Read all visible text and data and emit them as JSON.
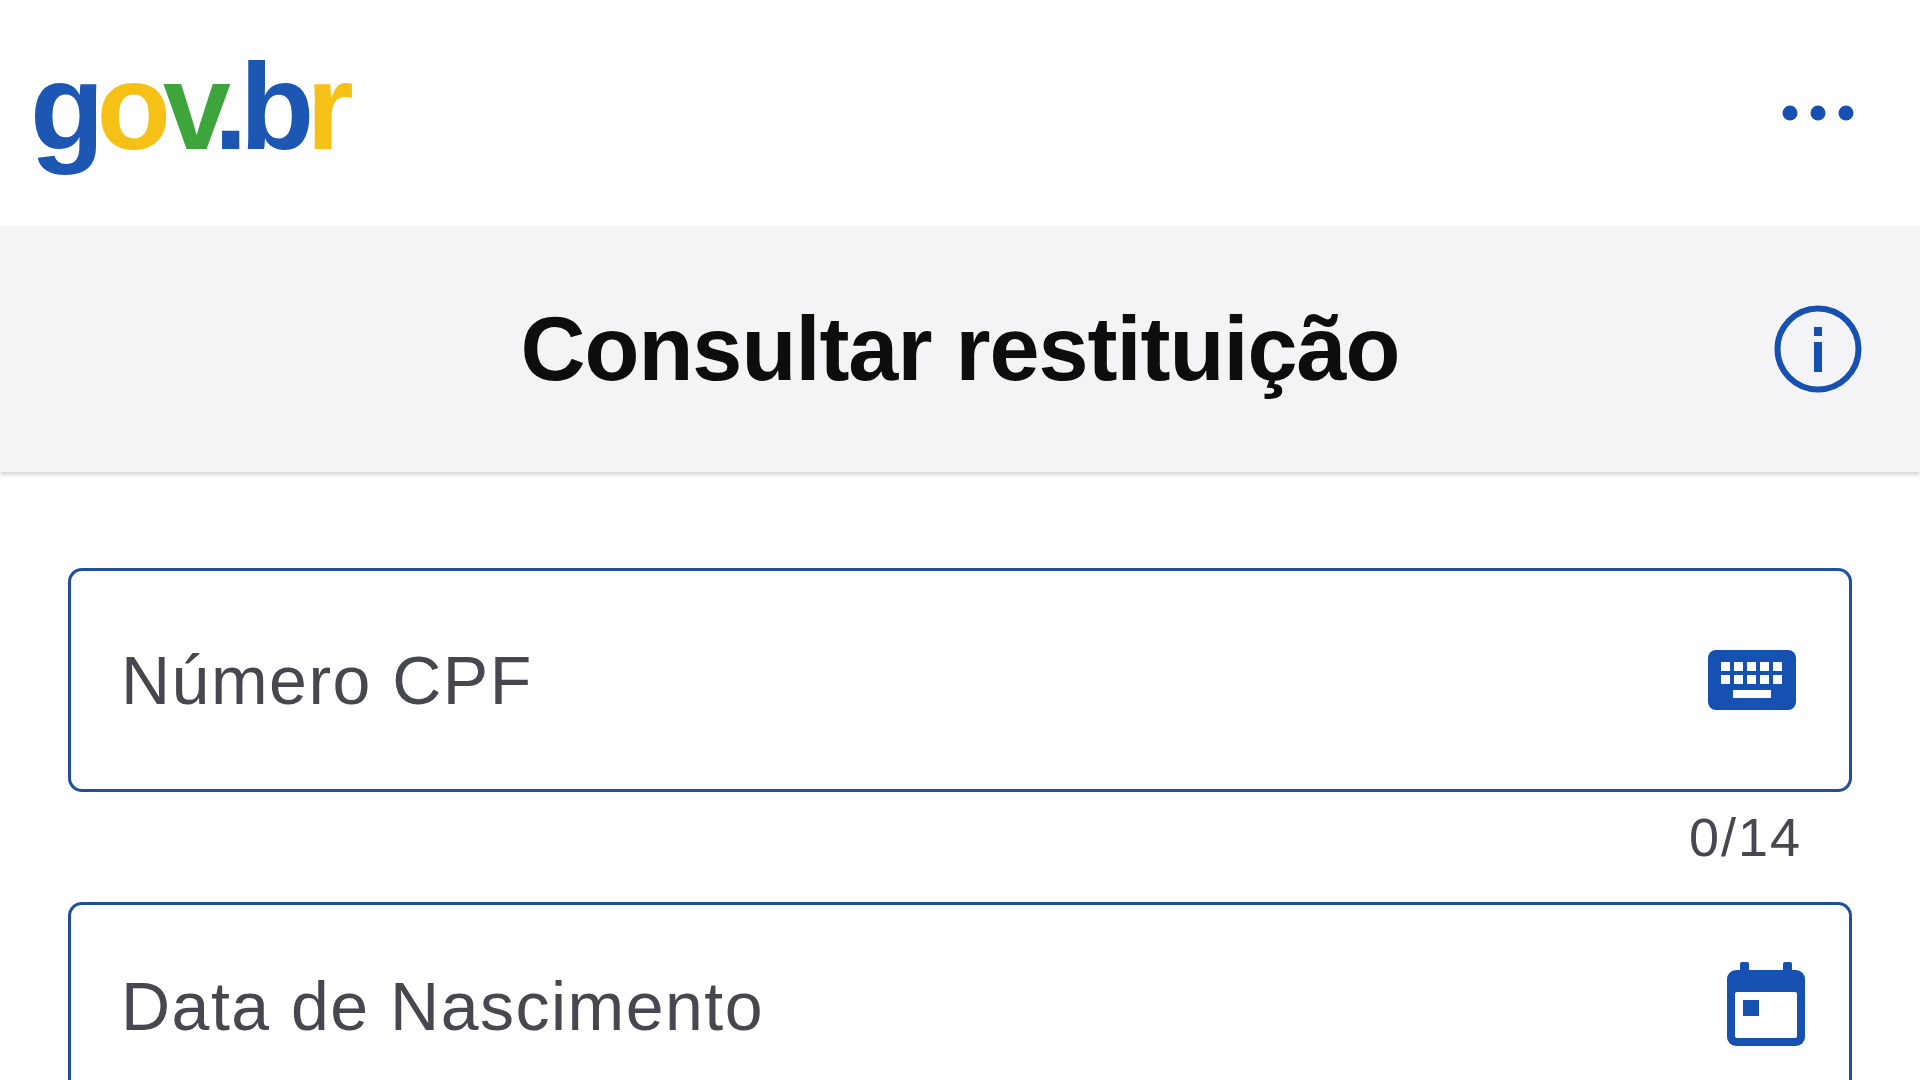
{
  "header": {
    "logo": "gov.br"
  },
  "title_bar": {
    "title": "Consultar restituição"
  },
  "form": {
    "fields": [
      {
        "kind": "cpf",
        "placeholder": "Número CPF",
        "counter": "0/14"
      },
      {
        "kind": "date",
        "placeholder": "Data de Nascimento"
      }
    ]
  }
}
